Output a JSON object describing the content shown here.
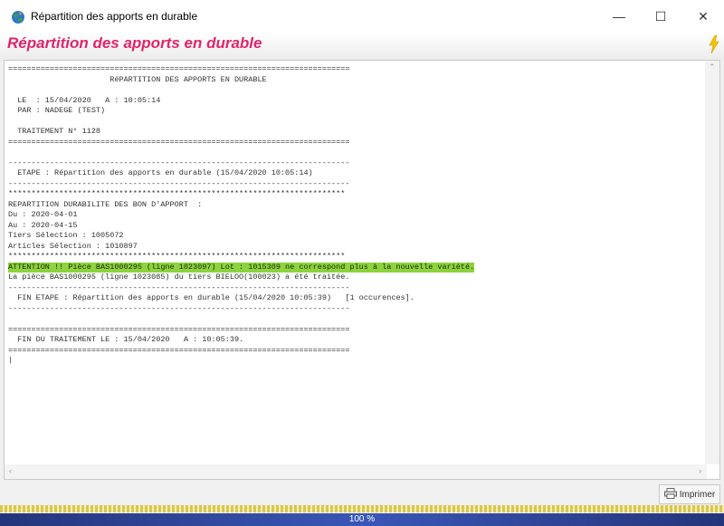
{
  "window": {
    "title": "Répartition des apports en durable",
    "minimize_glyph": "—",
    "maximize_glyph": "☐",
    "close_glyph": "✕"
  },
  "header": {
    "title": "Répartition des apports en durable",
    "action_icon": "lightning-bolt-icon"
  },
  "report": {
    "lines_before": [
      "==========================================================================",
      "                      RéPARTITION DES APPORTS EN DURABLE",
      "",
      "  LE  : 15/04/2020   A : 10:05:14",
      "  PAR : NADEGE (TEST)",
      "",
      "  TRAITEMENT N° 1128",
      "==========================================================================",
      "",
      "--------------------------------------------------------------------------",
      "  ETAPE : Répartition des apports en durable (15/04/2020 10:05:14)",
      "--------------------------------------------------------------------------",
      "*************************************************************************",
      "REPARTITION DURABILITE DES BON D'APPORT  :",
      "Du : 2020-04-01",
      "Au : 2020-04-15",
      "Tiers Sélection : 1005072",
      "Articles Sélection : 1010897",
      "*************************************************************************"
    ],
    "highlight_line": "ATTENTION !! Pièce BAS1000295 (ligne 1023097) Lot : 1015309 ne correspond plus à la nouvelle variété.",
    "lines_after": [
      "La pièce BAS1000295 (ligne 1023085) du tiers BIELOO(100023) a été traitée.",
      "--------------------------------------------------------------------------",
      "  FIN ETAPE : Répartition des apports en durable (15/04/2020 10:05:39)   [1 occurences].",
      "--------------------------------------------------------------------------",
      "",
      "==========================================================================",
      "  FIN DU TRAITEMENT LE : 15/04/2020   A : 10:05:39.",
      "==========================================================================",
      "|"
    ]
  },
  "footer": {
    "print_label": "Imprimer",
    "print_icon": "printer-icon",
    "progress_text": "100 %",
    "progress_value": 1.0
  },
  "colors": {
    "title_pink": "#e0256b",
    "highlight_green": "#8cd33d",
    "progress_blue": "#24357a"
  }
}
